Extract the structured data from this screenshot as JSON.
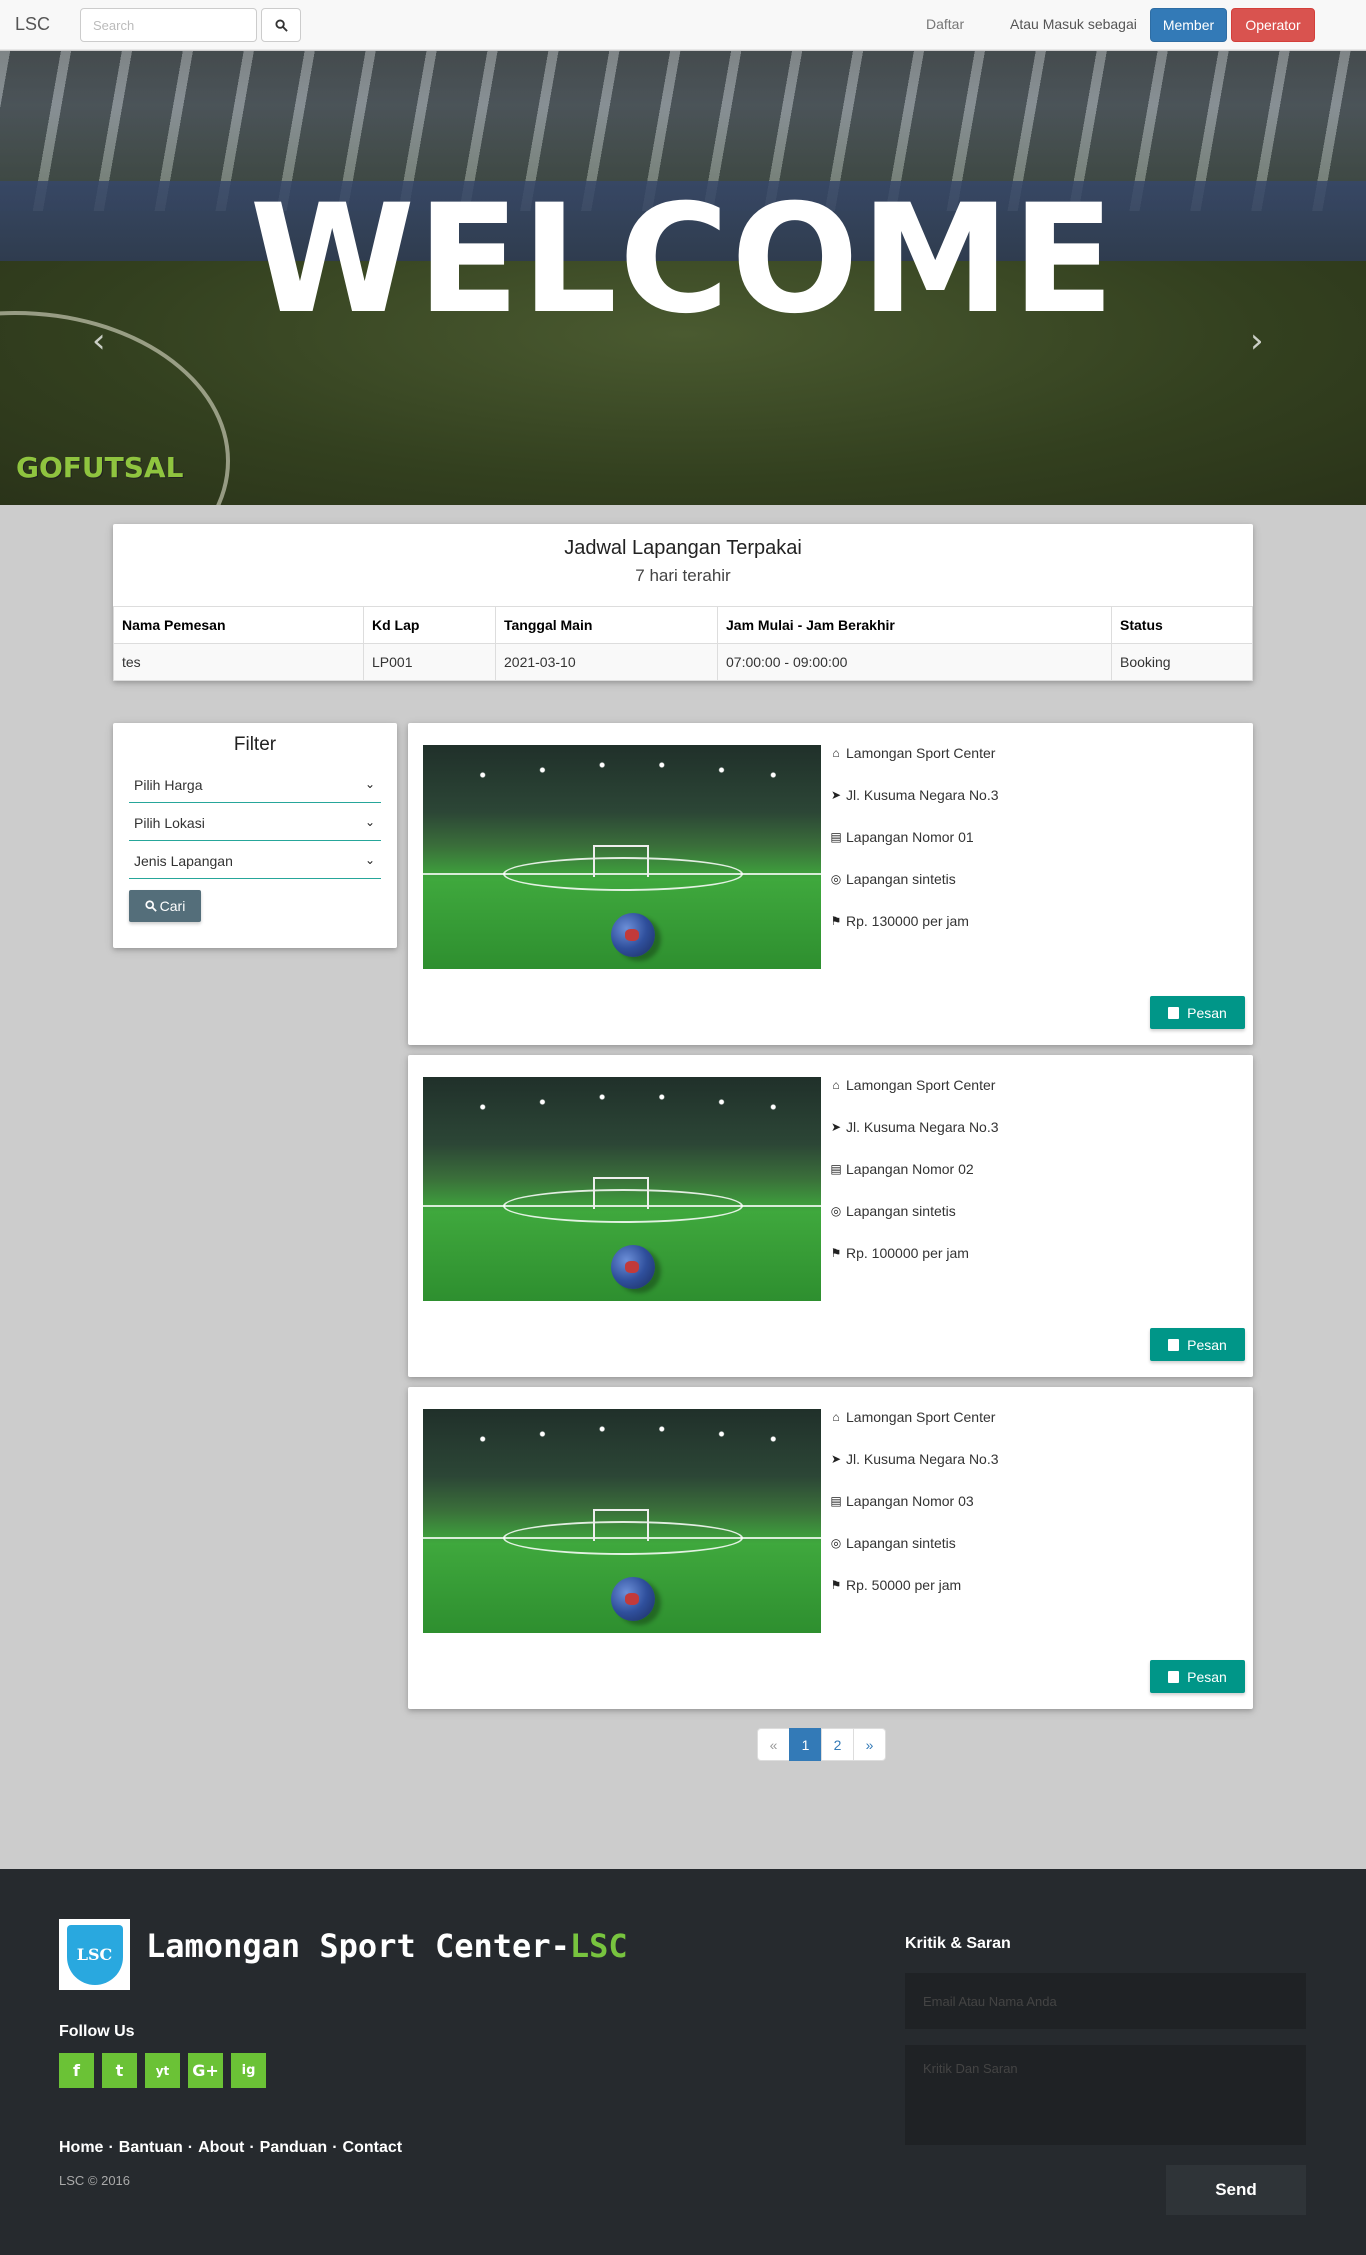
{
  "navbar": {
    "brand": "LSC",
    "search_placeholder": "Search",
    "daftar": "Daftar",
    "login_text": "Atau Masuk sebagai",
    "member_label": "Member",
    "operator_label": "Operator"
  },
  "hero": {
    "title": "WELCOME",
    "logo_text": "GOFUTSAL",
    "prev": "‹",
    "next": "›"
  },
  "schedule": {
    "title": "Jadwal Lapangan Terpakai",
    "subtitle": "7 hari terahir",
    "columns": [
      "Nama Pemesan",
      "Kd Lap",
      "Tanggal Main",
      "Jam Mulai - Jam Berakhir",
      "Status"
    ],
    "rows": [
      [
        "tes",
        "LP001",
        "2021-03-10",
        "07:00:00 - 09:00:00",
        "Booking"
      ]
    ]
  },
  "filter": {
    "title": "Filter",
    "harga": "Pilih Harga",
    "lokasi": "Pilih Lokasi",
    "jenis": "Jenis Lapangan",
    "cari": "Cari"
  },
  "fields": [
    {
      "venue": "Lamongan Sport Center",
      "address": "Jl. Kusuma Negara No.3",
      "name": "Lapangan Nomor 01",
      "type": "Lapangan sintetis",
      "price": "Rp. 130000 per jam",
      "button": "Pesan"
    },
    {
      "venue": "Lamongan Sport Center",
      "address": "Jl. Kusuma Negara No.3",
      "name": "Lapangan Nomor 02",
      "type": "Lapangan sintetis",
      "price": "Rp. 100000 per jam",
      "button": "Pesan"
    },
    {
      "venue": "Lamongan Sport Center",
      "address": "Jl. Kusuma Negara No.3",
      "name": "Lapangan Nomor 03",
      "type": "Lapangan sintetis",
      "price": "Rp. 50000 per jam",
      "button": "Pesan"
    }
  ],
  "pagination": {
    "prev": "«",
    "pages": [
      "1",
      "2"
    ],
    "next": "»",
    "active": "1"
  },
  "footer": {
    "logo_text": "LSC",
    "brand_main": "Lamongan Sport Center-",
    "brand_accent": "LSC",
    "follow": "Follow Us",
    "socials": [
      "f",
      "t",
      "yt",
      "G+",
      "ig"
    ],
    "links": [
      "Home",
      "·",
      "Bantuan",
      "·",
      "About",
      "·",
      "Panduan",
      "·",
      "Contact"
    ],
    "copyright": "LSC © 2016",
    "kritik_title": "Kritik & Saran",
    "email_placeholder": "Email Atau Nama Anda",
    "message_placeholder": "Kritik Dan Saran",
    "send": "Send"
  },
  "colors": {
    "primary": "#337ab7",
    "danger": "#d9534f",
    "teal": "#009688",
    "green": "#6bc236",
    "footer_bg": "#262a2e"
  }
}
